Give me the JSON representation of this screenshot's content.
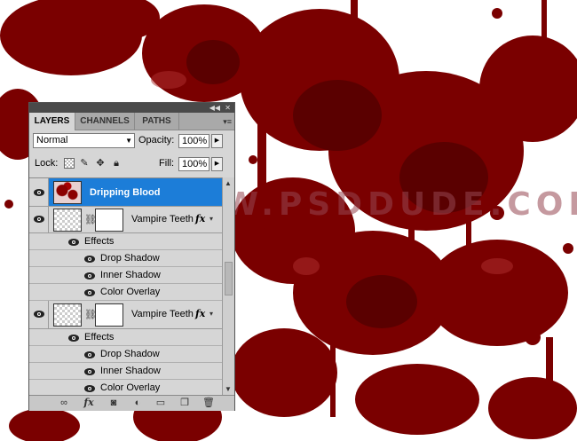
{
  "colors": {
    "blood": "#7a0000",
    "blood_dark": "#5a0000",
    "selection": "#1c7dd8",
    "panel": "#d6d6d6"
  },
  "watermark": "WWW.PSDDUDE.COM",
  "panel": {
    "tabs": [
      "LAYERS",
      "CHANNELS",
      "PATHS"
    ],
    "active_tab": "LAYERS",
    "blend_mode": "Normal",
    "opacity_label": "Opacity:",
    "opacity_value": "100%",
    "lock_label": "Lock:",
    "fill_label": "Fill:",
    "fill_value": "100%",
    "layers": [
      {
        "name": "Dripping Blood",
        "selected": true,
        "visible": true
      },
      {
        "name": "Vampire Teeth",
        "visible": true,
        "effects_label": "Effects",
        "effects": [
          "Drop Shadow",
          "Inner Shadow",
          "Color Overlay"
        ]
      },
      {
        "name": "Vampire Teeth",
        "visible": true,
        "effects_label": "Effects",
        "effects": [
          "Drop Shadow",
          "Inner Shadow",
          "Color Overlay"
        ]
      }
    ],
    "footer_icons": [
      "link-layers-icon",
      "fx-icon",
      "add-mask-icon",
      "adjustment-layer-icon",
      "new-group-icon",
      "new-layer-icon",
      "trash-icon"
    ]
  }
}
